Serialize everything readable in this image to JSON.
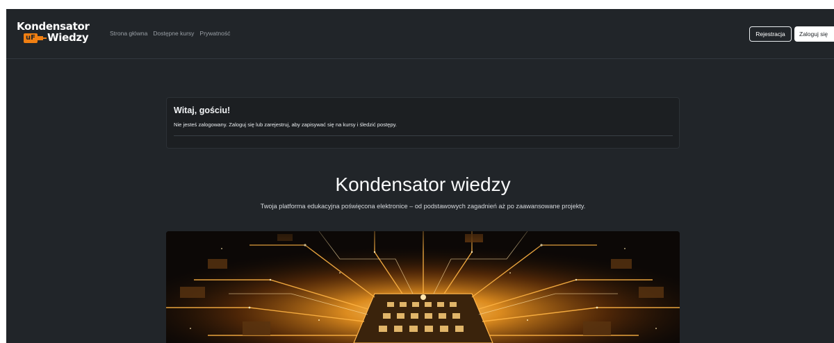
{
  "brand": {
    "line1": "Kondensator",
    "badge": "uF",
    "line2": "Wiedzy"
  },
  "nav": {
    "links": [
      "Strona główna",
      "Dostępne kursy",
      "Prywatność"
    ]
  },
  "auth": {
    "register_label": "Rejestracja",
    "login_label": "Zaloguj się"
  },
  "welcome": {
    "title": "Witaj, gościu!",
    "text": "Nie jesteś zalogowany. Zaloguj się lub zarejestruj, aby zapisywać się na kursy i śledzić postępy."
  },
  "hero": {
    "title": "Kondensator wiedzy",
    "subtitle": "Twoja platforma edukacyjna poświęcona elektronice – od podstawowych zagadnień aż po zaawansowane projekty."
  },
  "colors": {
    "background": "#212529",
    "accent": "#f07f12",
    "text": "#f8f9fa"
  }
}
